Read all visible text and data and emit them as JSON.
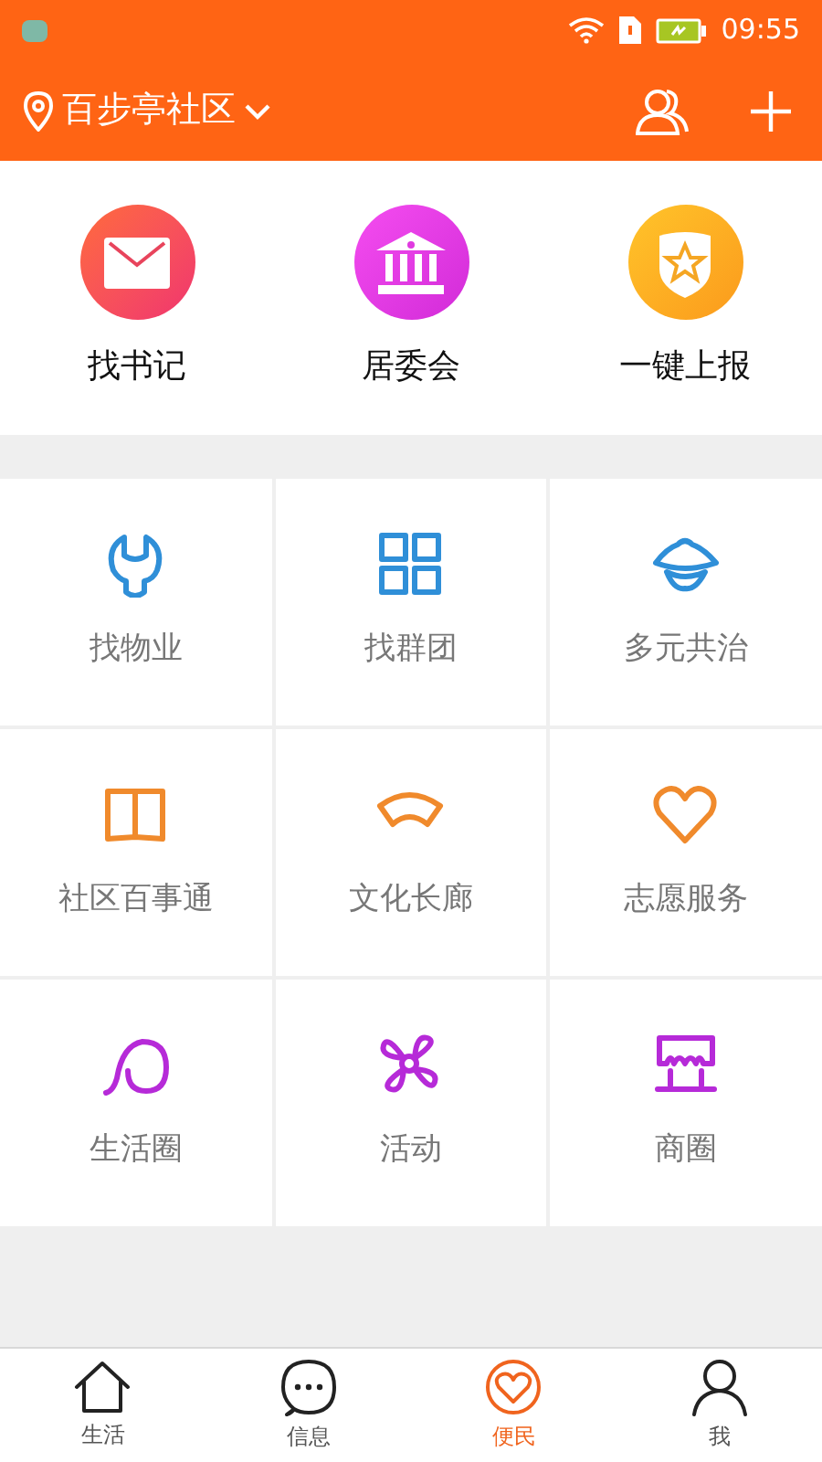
{
  "status_bar": {
    "time": "09:55"
  },
  "header": {
    "community": "百步亭社区"
  },
  "quick_actions": [
    {
      "label": "找书记",
      "kind": "mail"
    },
    {
      "label": "居委会",
      "kind": "bank"
    },
    {
      "label": "一键上报",
      "kind": "shield"
    }
  ],
  "services": [
    {
      "label": "找物业",
      "kind": "wrench",
      "color": "#2f8fd8"
    },
    {
      "label": "找群团",
      "kind": "grid",
      "color": "#2f8fd8"
    },
    {
      "label": "多元共治",
      "kind": "hat",
      "color": "#2f8fd8"
    },
    {
      "label": "社区百事通",
      "kind": "book",
      "color": "#f08a2c"
    },
    {
      "label": "文化长廊",
      "kind": "fan",
      "color": "#f08a2c"
    },
    {
      "label": "志愿服务",
      "kind": "heart",
      "color": "#f08a2c"
    },
    {
      "label": "生活圈",
      "kind": "loop",
      "color": "#b62ad8"
    },
    {
      "label": "活动",
      "kind": "pinwheel",
      "color": "#b62ad8"
    },
    {
      "label": "商圈",
      "kind": "shop",
      "color": "#b62ad8"
    }
  ],
  "tabs": [
    {
      "label": "生活",
      "kind": "home",
      "selected": false
    },
    {
      "label": "信息",
      "kind": "chat",
      "selected": false
    },
    {
      "label": "便民",
      "kind": "heart",
      "selected": true
    },
    {
      "label": "我",
      "kind": "person",
      "selected": false
    }
  ]
}
